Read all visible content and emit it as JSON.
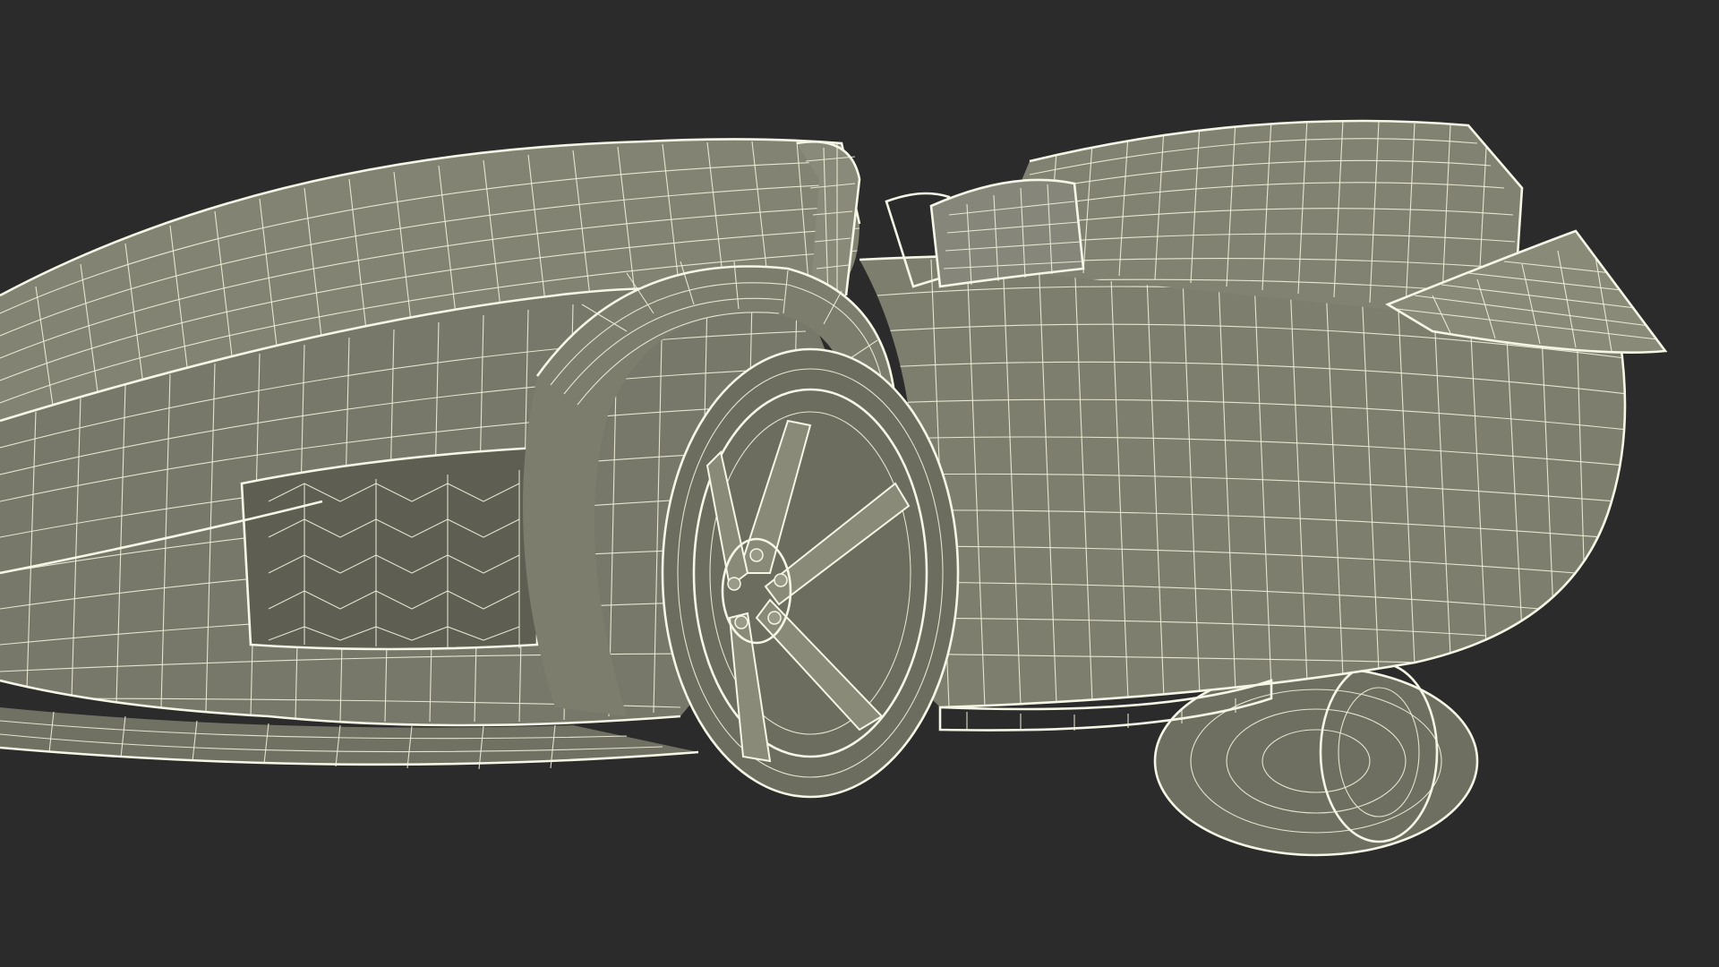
{
  "viewport": {
    "background_color": "#2b2b2b"
  },
  "render": {
    "style": "wireframe-on-shaded",
    "surface_color": "#7c7c6c",
    "surface_shadow_color": "#5f5f52",
    "surface_highlight_color": "#8b8b7a",
    "wire_color": "#f1f1dc"
  },
  "subject": {
    "icon": "car-wireframe-icon"
  }
}
